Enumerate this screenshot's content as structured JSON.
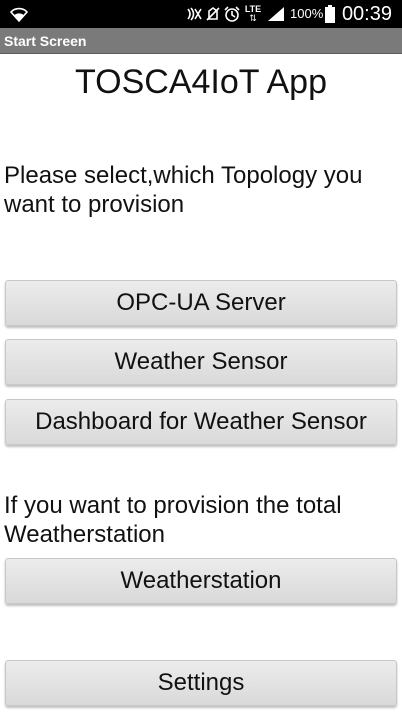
{
  "status_bar": {
    "battery_percent": "100%",
    "time": "00:39",
    "network_label": "LTE",
    "icons": [
      "wifi-icon",
      "nfc-icon",
      "mute-icon",
      "alarm-icon",
      "lte-icon",
      "signal-icon",
      "battery-icon"
    ]
  },
  "title_bar": {
    "title": "Start Screen"
  },
  "main": {
    "app_title": "TOSCA4IoT App",
    "topology_prompt": "Please select,which Topology you want to provision",
    "buttons": {
      "opc_ua": "OPC-UA Server",
      "weather_sensor": "Weather Sensor",
      "dashboard": "Dashboard for Weather Sensor",
      "weatherstation": "Weatherstation",
      "settings": "Settings"
    },
    "total_prompt": "If you want to provision the total Weatherstation"
  },
  "colors": {
    "status_bar_bg": "#000000",
    "title_bar_bg": "#7a7a7a",
    "button_bg": "#e2e2e2",
    "text": "#111111"
  }
}
